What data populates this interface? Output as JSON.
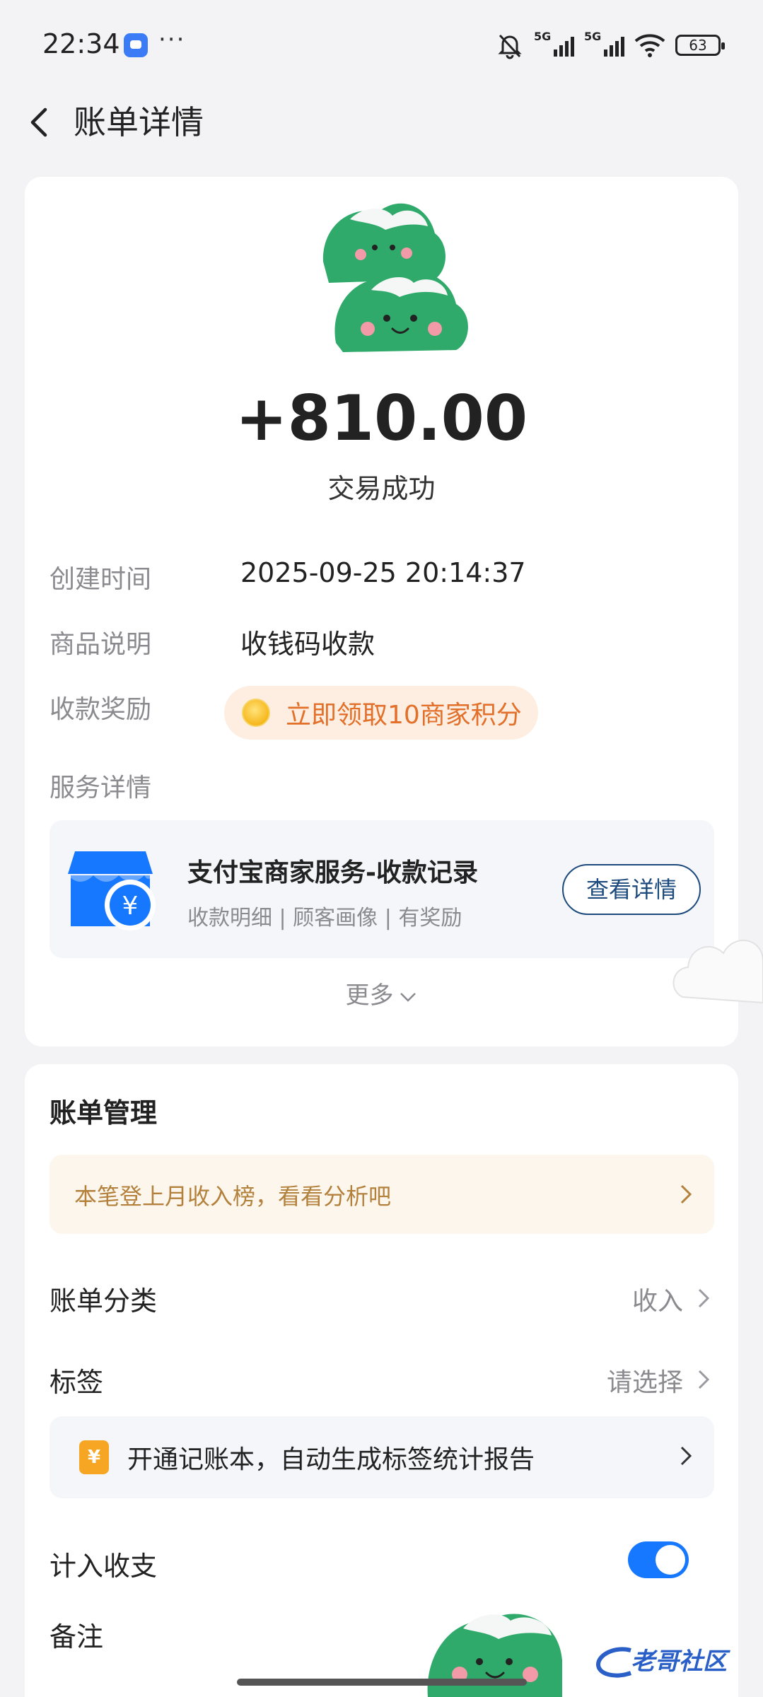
{
  "status_bar": {
    "time": "22:34",
    "more": "···",
    "network1": "5G",
    "network2": "5G",
    "battery": "63",
    "icons": [
      "chat-app-icon",
      "mute-bell-icon",
      "signal-icon",
      "wifi-icon",
      "battery-icon"
    ]
  },
  "nav": {
    "title": "账单详情",
    "back_icon": "chevron-left-icon"
  },
  "transaction": {
    "amount": "+810.00",
    "status": "交易成功"
  },
  "details": {
    "created_label": "创建时间",
    "created_value": "2025-09-25 20:14:37",
    "product_label": "商品说明",
    "product_value": "收钱码收款",
    "reward_label": "收款奖励",
    "reward_text": "立即领取10商家积分",
    "service_label": "服务详情"
  },
  "service": {
    "title": "支付宝商家服务-收款记录",
    "subtitle": "收款明细 | 顾客画像 | 有奖励",
    "button": "查看详情"
  },
  "more_label": "更多",
  "bill_management": {
    "title": "账单管理",
    "tip": "本笔登上月收入榜，看看分析吧",
    "category_label": "账单分类",
    "category_value": "收入",
    "tag_label": "标签",
    "tag_value": "请选择",
    "bookkeeping_icon": "¥",
    "bookkeeping_text": "开通记账本，自动生成标签统计报告",
    "include_label": "计入收支",
    "include_on": true,
    "note_label": "备注"
  },
  "watermark": "老哥社区",
  "colors": {
    "accent_blue": "#1677ff",
    "reward_orange": "#e2702a",
    "tip_gold": "#b4813c",
    "button_navy": "#1d4a7d"
  }
}
